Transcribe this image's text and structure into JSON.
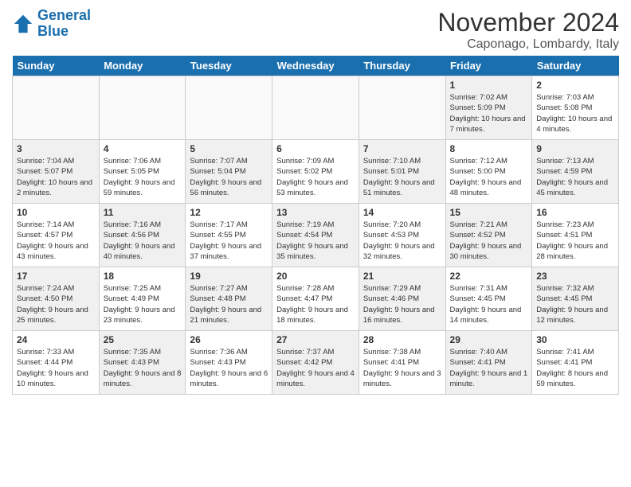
{
  "logo": {
    "line1": "General",
    "line2": "Blue"
  },
  "title": "November 2024",
  "location": "Caponago, Lombardy, Italy",
  "days_of_week": [
    "Sunday",
    "Monday",
    "Tuesday",
    "Wednesday",
    "Thursday",
    "Friday",
    "Saturday"
  ],
  "weeks": [
    [
      {
        "day": "",
        "info": "",
        "empty": true
      },
      {
        "day": "",
        "info": "",
        "empty": true
      },
      {
        "day": "",
        "info": "",
        "empty": true
      },
      {
        "day": "",
        "info": "",
        "empty": true
      },
      {
        "day": "",
        "info": "",
        "empty": true
      },
      {
        "day": "1",
        "info": "Sunrise: 7:02 AM\nSunset: 5:09 PM\nDaylight: 10 hours and 7 minutes.",
        "shaded": true
      },
      {
        "day": "2",
        "info": "Sunrise: 7:03 AM\nSunset: 5:08 PM\nDaylight: 10 hours and 4 minutes.",
        "shaded": false
      }
    ],
    [
      {
        "day": "3",
        "info": "Sunrise: 7:04 AM\nSunset: 5:07 PM\nDaylight: 10 hours and 2 minutes.",
        "shaded": true
      },
      {
        "day": "4",
        "info": "Sunrise: 7:06 AM\nSunset: 5:05 PM\nDaylight: 9 hours and 59 minutes.",
        "shaded": false
      },
      {
        "day": "5",
        "info": "Sunrise: 7:07 AM\nSunset: 5:04 PM\nDaylight: 9 hours and 56 minutes.",
        "shaded": true
      },
      {
        "day": "6",
        "info": "Sunrise: 7:09 AM\nSunset: 5:02 PM\nDaylight: 9 hours and 53 minutes.",
        "shaded": false
      },
      {
        "day": "7",
        "info": "Sunrise: 7:10 AM\nSunset: 5:01 PM\nDaylight: 9 hours and 51 minutes.",
        "shaded": true
      },
      {
        "day": "8",
        "info": "Sunrise: 7:12 AM\nSunset: 5:00 PM\nDaylight: 9 hours and 48 minutes.",
        "shaded": false
      },
      {
        "day": "9",
        "info": "Sunrise: 7:13 AM\nSunset: 4:59 PM\nDaylight: 9 hours and 45 minutes.",
        "shaded": true
      }
    ],
    [
      {
        "day": "10",
        "info": "Sunrise: 7:14 AM\nSunset: 4:57 PM\nDaylight: 9 hours and 43 minutes.",
        "shaded": false
      },
      {
        "day": "11",
        "info": "Sunrise: 7:16 AM\nSunset: 4:56 PM\nDaylight: 9 hours and 40 minutes.",
        "shaded": true
      },
      {
        "day": "12",
        "info": "Sunrise: 7:17 AM\nSunset: 4:55 PM\nDaylight: 9 hours and 37 minutes.",
        "shaded": false
      },
      {
        "day": "13",
        "info": "Sunrise: 7:19 AM\nSunset: 4:54 PM\nDaylight: 9 hours and 35 minutes.",
        "shaded": true
      },
      {
        "day": "14",
        "info": "Sunrise: 7:20 AM\nSunset: 4:53 PM\nDaylight: 9 hours and 32 minutes.",
        "shaded": false
      },
      {
        "day": "15",
        "info": "Sunrise: 7:21 AM\nSunset: 4:52 PM\nDaylight: 9 hours and 30 minutes.",
        "shaded": true
      },
      {
        "day": "16",
        "info": "Sunrise: 7:23 AM\nSunset: 4:51 PM\nDaylight: 9 hours and 28 minutes.",
        "shaded": false
      }
    ],
    [
      {
        "day": "17",
        "info": "Sunrise: 7:24 AM\nSunset: 4:50 PM\nDaylight: 9 hours and 25 minutes.",
        "shaded": true
      },
      {
        "day": "18",
        "info": "Sunrise: 7:25 AM\nSunset: 4:49 PM\nDaylight: 9 hours and 23 minutes.",
        "shaded": false
      },
      {
        "day": "19",
        "info": "Sunrise: 7:27 AM\nSunset: 4:48 PM\nDaylight: 9 hours and 21 minutes.",
        "shaded": true
      },
      {
        "day": "20",
        "info": "Sunrise: 7:28 AM\nSunset: 4:47 PM\nDaylight: 9 hours and 18 minutes.",
        "shaded": false
      },
      {
        "day": "21",
        "info": "Sunrise: 7:29 AM\nSunset: 4:46 PM\nDaylight: 9 hours and 16 minutes.",
        "shaded": true
      },
      {
        "day": "22",
        "info": "Sunrise: 7:31 AM\nSunset: 4:45 PM\nDaylight: 9 hours and 14 minutes.",
        "shaded": false
      },
      {
        "day": "23",
        "info": "Sunrise: 7:32 AM\nSunset: 4:45 PM\nDaylight: 9 hours and 12 minutes.",
        "shaded": true
      }
    ],
    [
      {
        "day": "24",
        "info": "Sunrise: 7:33 AM\nSunset: 4:44 PM\nDaylight: 9 hours and 10 minutes.",
        "shaded": false
      },
      {
        "day": "25",
        "info": "Sunrise: 7:35 AM\nSunset: 4:43 PM\nDaylight: 9 hours and 8 minutes.",
        "shaded": true
      },
      {
        "day": "26",
        "info": "Sunrise: 7:36 AM\nSunset: 4:43 PM\nDaylight: 9 hours and 6 minutes.",
        "shaded": false
      },
      {
        "day": "27",
        "info": "Sunrise: 7:37 AM\nSunset: 4:42 PM\nDaylight: 9 hours and 4 minutes.",
        "shaded": true
      },
      {
        "day": "28",
        "info": "Sunrise: 7:38 AM\nSunset: 4:41 PM\nDaylight: 9 hours and 3 minutes.",
        "shaded": false
      },
      {
        "day": "29",
        "info": "Sunrise: 7:40 AM\nSunset: 4:41 PM\nDaylight: 9 hours and 1 minute.",
        "shaded": true
      },
      {
        "day": "30",
        "info": "Sunrise: 7:41 AM\nSunset: 4:41 PM\nDaylight: 8 hours and 59 minutes.",
        "shaded": false
      }
    ]
  ]
}
